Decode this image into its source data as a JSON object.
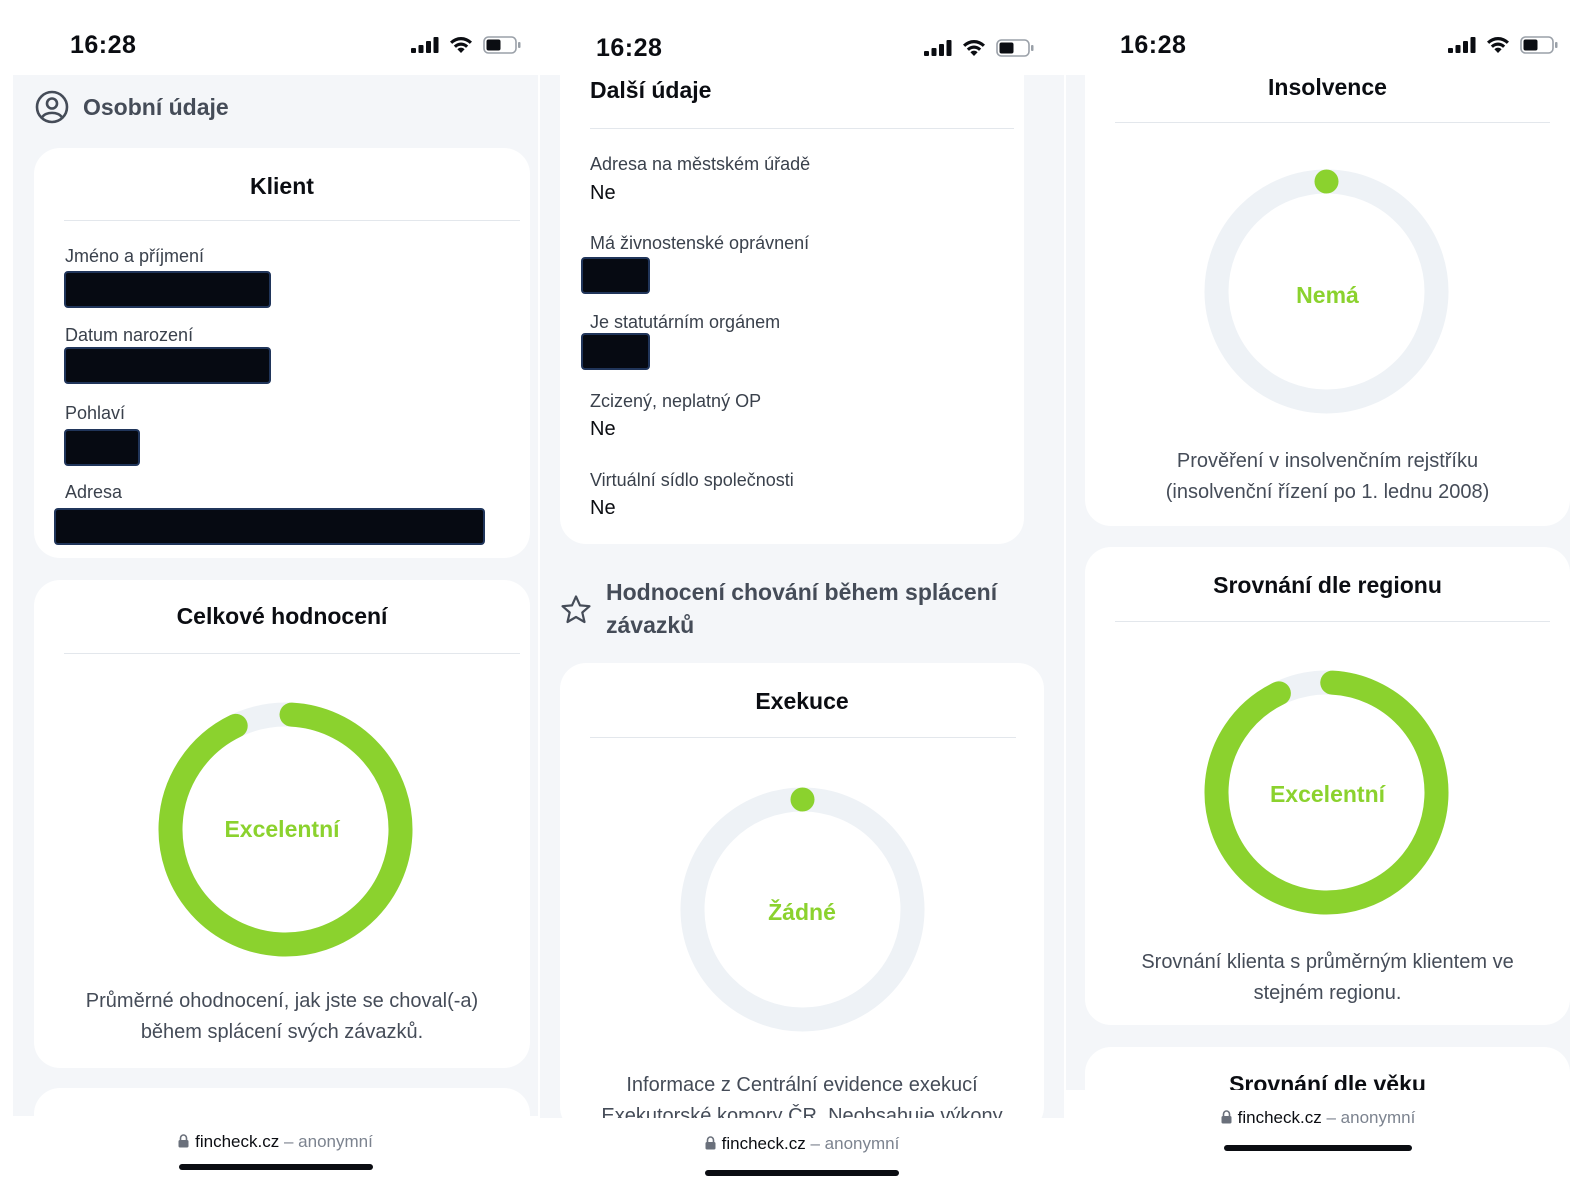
{
  "status_bar": {
    "time": "16:28"
  },
  "browser": {
    "domain": "fincheck.cz",
    "separator": "–",
    "mode": "anonymní"
  },
  "colors": {
    "accent": "#8bd22e",
    "ring_track": "#eef2f6",
    "background": "#f4f6f9"
  },
  "screen1": {
    "section_title": "Osobní údaje",
    "section_icon": "user-circle-icon",
    "client_card": {
      "title": "Klient",
      "fields": [
        {
          "label": "Jméno a příjmení"
        },
        {
          "label": "Datum narození"
        },
        {
          "label": "Pohlaví"
        },
        {
          "label": "Adresa"
        }
      ]
    },
    "overall_card": {
      "title": "Celkové hodnocení",
      "gauge_label": "Excelentní",
      "gauge_fraction": 0.92,
      "description_line1": "Průměrné ohodnocení, jak jste se choval(-a)",
      "description_line2": "během splácení svých závazků."
    }
  },
  "screen2": {
    "card_title": "Další údaje",
    "fields": [
      {
        "label": "Adresa na městském úřadě",
        "value": "Ne"
      },
      {
        "label": "Má živnostenské oprávnení"
      },
      {
        "label": "Je statutárním orgánem"
      },
      {
        "label": "Zcizený, neplatný OP",
        "value": "Ne"
      },
      {
        "label": "Virtuální sídlo společnosti",
        "value": "Ne"
      }
    ],
    "section_title_line1": "Hodnocení chování během splácení",
    "section_title_line2": "závazků",
    "section_icon": "star-outline-icon",
    "execution_card": {
      "title": "Exekuce",
      "gauge_label": "Žádné",
      "gauge_fraction": 0,
      "description_line1": "Informace z Centrální evidence exekucí",
      "description_line2": "Exekutorské komory ČR. Neobsahuje výkony"
    }
  },
  "screen3": {
    "insolvency_card": {
      "title": "Insolvence",
      "gauge_label": "Nemá",
      "gauge_fraction": 0,
      "description_line1": "Prověření v insolvenčním rejstříku",
      "description_line2": "(insolvenční řízení po 1. lednu 2008)"
    },
    "region_card": {
      "title": "Srovnání dle regionu",
      "gauge_label": "Excelentní",
      "gauge_fraction": 0.92,
      "description_line1": "Srovnání klienta s průměrným klientem ve",
      "description_line2": "stejném regionu."
    },
    "age_card": {
      "title": "Srovnání dle věku"
    }
  }
}
